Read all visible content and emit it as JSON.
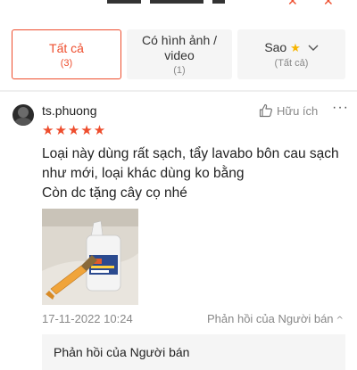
{
  "filters": [
    {
      "main": "Tất cả",
      "sub": "(3)"
    },
    {
      "main": "Có hình ảnh / video",
      "sub": "(1)"
    },
    {
      "main": "Sao",
      "sub": "(Tất cả)"
    }
  ],
  "review": {
    "username": "ts.phuong",
    "helpful_label": "Hữu ích",
    "more_label": "···",
    "rating": 5,
    "stars_text": "★★★★★",
    "text_lines": [
      "Loại này dùng rất sạch, tẩy lavabo bôn cau sạch như mới, loại khác dùng ko bằng",
      "Còn dc tặng cây cọ nhé"
    ],
    "date": "17-11-2022 10:24",
    "seller_reply_toggle": "Phản hồi của Người bán",
    "seller_reply_title": "Phản hồi của Người bán"
  },
  "icons": [
    "cart-icon",
    "star-icon",
    "chevron-down-icon",
    "thumbs-up-icon",
    "more-icon",
    "chevron-up-icon"
  ],
  "colors": {
    "accent": "#ee4d2d",
    "star": "#f7b500"
  }
}
